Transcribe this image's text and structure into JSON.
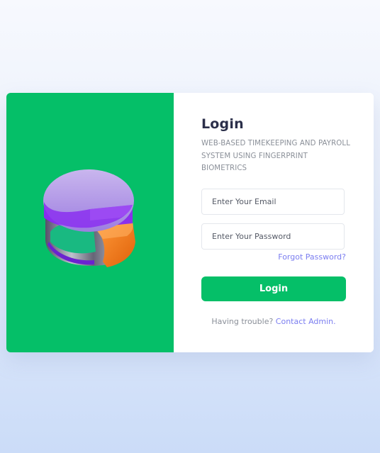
{
  "login": {
    "title": "Login",
    "subtitle": "WEB-BASED TIMEKEEPING AND PAYROLL SYSTEM USING FINGERPRINT BIOMETRICS",
    "email_placeholder": "Enter Your Email",
    "password_placeholder": "Enter Your Password",
    "forgot_password": "Forgot Password?",
    "login_button": "Login",
    "help_text": "Having trouble?",
    "contact_link": "Contact Admin."
  },
  "illustration": {
    "icon": "pie-chart-3d-icon"
  },
  "colors": {
    "accent_green": "#05bf68",
    "link_purple": "#7b7ef0",
    "title_dark": "#2b2f4a",
    "muted_text": "#8a8f98"
  }
}
